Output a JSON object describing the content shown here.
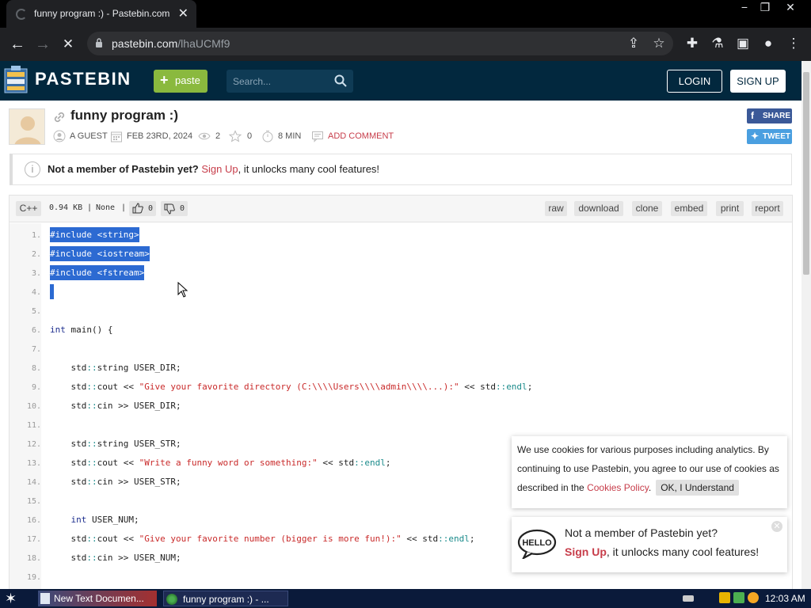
{
  "browser": {
    "tab_title": "funny program :) - Pastebin.com",
    "url_host": "pastebin.com",
    "url_path": "/lhaUCMf9"
  },
  "header": {
    "brand": "PASTEBIN",
    "paste_label": "paste",
    "search_placeholder": "Search...",
    "login_label": "LOGIN",
    "signup_label": "SIGN UP"
  },
  "paste": {
    "title": "funny program :)",
    "author": "A GUEST",
    "date": "FEB 23RD, 2024",
    "views": "2",
    "stars": "0",
    "read_time": "8 MIN",
    "add_comment": "ADD COMMENT",
    "share_label": "SHARE",
    "tweet_label": "TWEET"
  },
  "notice": {
    "prefix": "Not a member of Pastebin yet? ",
    "link": "Sign Up",
    "suffix": ", it unlocks many cool features!"
  },
  "code_header": {
    "language": "C++",
    "size": "0.94 KB",
    "category": "None",
    "likes": "0",
    "dislikes": "0",
    "actions": [
      "raw",
      "download",
      "clone",
      "embed",
      "print",
      "report"
    ]
  },
  "code_lines": [
    {
      "n": "1.",
      "text": "#include <string>"
    },
    {
      "n": "2.",
      "text": "#include <iostream>"
    },
    {
      "n": "3.",
      "text": "#include <fstream>"
    },
    {
      "n": "4.",
      "text": ""
    },
    {
      "n": "5.",
      "text": ""
    },
    {
      "n": "6.",
      "text": "int main() {"
    },
    {
      "n": "7.",
      "text": ""
    },
    {
      "n": "8.",
      "text": "    std::string USER_DIR;"
    },
    {
      "n": "9.",
      "text": "    std::cout << \"Give your favorite directory (C:\\\\\\\\Users\\\\\\\\admin\\\\\\\\...):\" << std::endl;"
    },
    {
      "n": "10.",
      "text": "    std::cin >> USER_DIR;"
    },
    {
      "n": "11.",
      "text": ""
    },
    {
      "n": "12.",
      "text": "    std::string USER_STR;"
    },
    {
      "n": "13.",
      "text": "    std::cout << \"Write a funny word or something:\" << std::endl;"
    },
    {
      "n": "14.",
      "text": "    std::cin >> USER_STR;"
    },
    {
      "n": "15.",
      "text": ""
    },
    {
      "n": "16.",
      "text": "    int USER_NUM;"
    },
    {
      "n": "17.",
      "text": "    std::cout << \"Give your favorite number (bigger is more fun!):\" << std::endl;"
    },
    {
      "n": "18.",
      "text": "    std::cin >> USER_NUM;"
    },
    {
      "n": "19.",
      "text": ""
    }
  ],
  "cookie": {
    "text": "We use cookies for various purposes including analytics. By continuing to use Pastebin, you agree to our use of cookies as described in the ",
    "link": "Cookies Policy",
    "after_link": ".",
    "ok_label": "OK, I Understand"
  },
  "popup": {
    "line1": "Not a member of Pastebin yet?",
    "link": "Sign Up",
    "line2_suffix": ", it unlocks many cool features!"
  },
  "taskbar": {
    "item1": "New Text Documen...",
    "item2": "funny program :) - ...",
    "clock": "12:03 AM"
  }
}
